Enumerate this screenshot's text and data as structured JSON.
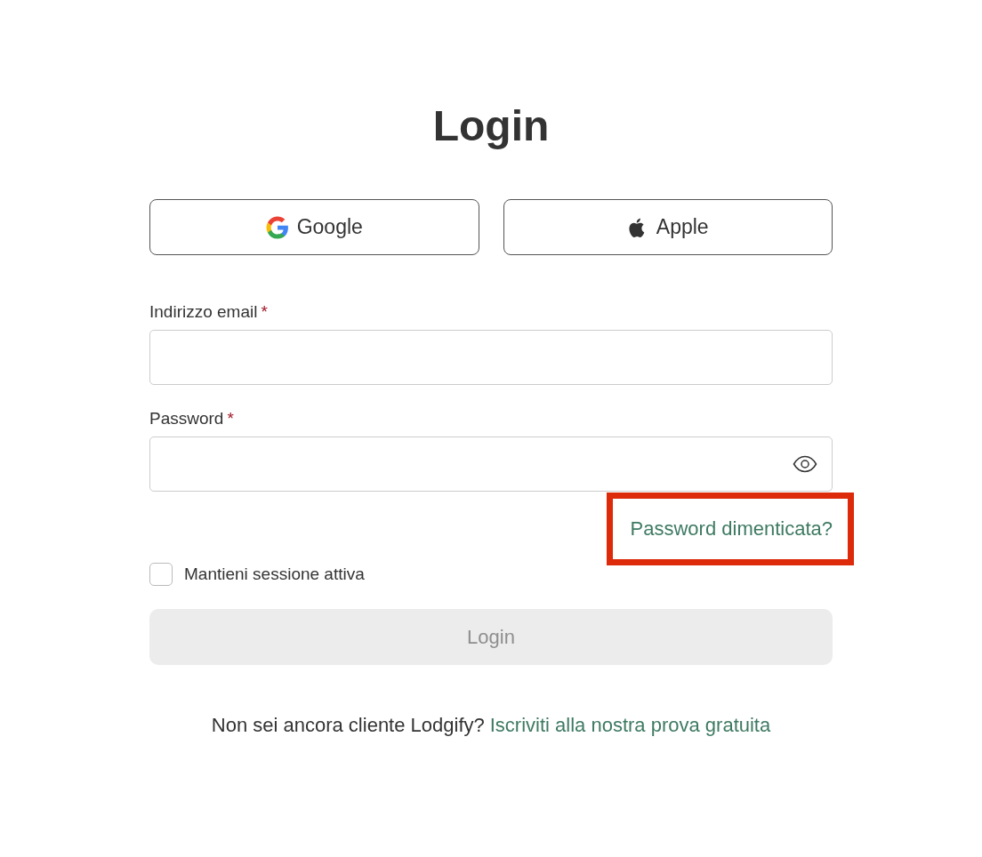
{
  "title": "Login",
  "social_buttons": [
    {
      "kind": "google",
      "label": "Google"
    },
    {
      "kind": "apple",
      "label": "Apple"
    }
  ],
  "fields": [
    {
      "kind": "email",
      "label": "Indirizzo email",
      "required_mark": "*"
    },
    {
      "kind": "password",
      "label": "Password",
      "required_mark": "*"
    }
  ],
  "forgot_link": {
    "label": "Password dimenticata?",
    "highlighted": true
  },
  "remember": {
    "label": "Mantieni sessione attiva",
    "checked": false
  },
  "submit": {
    "label": "Login",
    "disabled": true
  },
  "footer": {
    "text": "Non sei ancora cliente Lodgify?",
    "link": "Iscriviti alla nostra prova gratuita"
  }
}
